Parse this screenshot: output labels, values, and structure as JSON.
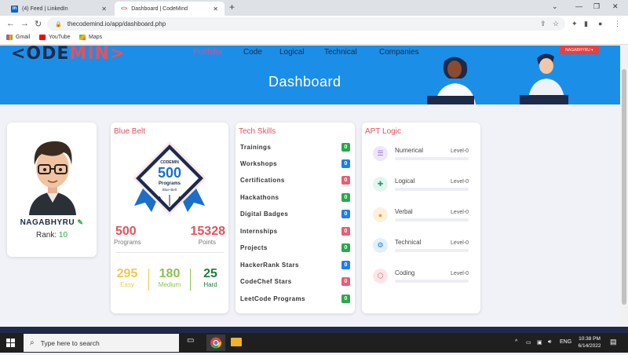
{
  "browser": {
    "tabs": [
      {
        "title": "(4) Feed | LinkedIn",
        "favicon": "linkedin-icon",
        "active": false
      },
      {
        "title": "Dashboard | CodeMind",
        "favicon": "codemind-icon",
        "active": true
      }
    ],
    "url": "thecodemind.io/app/dashboard.php",
    "bookmarks": [
      {
        "label": "Gmail",
        "icon": "gmail-icon"
      },
      {
        "label": "YouTube",
        "icon": "youtube-icon"
      },
      {
        "label": "Maps",
        "icon": "maps-icon"
      }
    ]
  },
  "site": {
    "logo_prefix": "<ODE",
    "logo_mid": "MIN",
    "logo_suffix": ">",
    "nav": [
      "Portfolio",
      "Code",
      "Logical",
      "Technical",
      "Companies"
    ],
    "active_nav": "Portfolio",
    "user_button": "NAGABHYRU ▾",
    "page_title": "Dashboard"
  },
  "profile": {
    "name": "NAGABHYRU",
    "rank_label": "Rank:",
    "rank_value": "10"
  },
  "belt": {
    "title": "Blue Belt",
    "badge": {
      "logo": "CODEMIN",
      "number": "500",
      "label": "Programs",
      "belt_label": "Blue-Belt"
    },
    "programs_value": "500",
    "programs_label": "Programs",
    "points_value": "15328",
    "points_label": "Points",
    "difficulties": [
      {
        "value": "295",
        "label": "Easy",
        "color": "#f2c94c"
      },
      {
        "value": "180",
        "label": "Medium",
        "color": "#8bc34a"
      },
      {
        "value": "25",
        "label": "Hard",
        "color": "#1e7d3a"
      }
    ]
  },
  "tech_skills": {
    "title": "Tech Skills",
    "items": [
      {
        "label": "Trainings",
        "value": "0",
        "color": "#2aa84a"
      },
      {
        "label": "Workshops",
        "value": "0",
        "color": "#1b7fe7"
      },
      {
        "label": "Certifications",
        "value": "0",
        "color": "#e85d75"
      },
      {
        "label": "Hackathons",
        "value": "0",
        "color": "#2aa84a"
      },
      {
        "label": "Digital Badges",
        "value": "0",
        "color": "#1b7fe7"
      },
      {
        "label": "Internships",
        "value": "0",
        "color": "#e85d75"
      },
      {
        "label": "Projects",
        "value": "0",
        "color": "#2aa84a"
      },
      {
        "label": "HackerRank Stars",
        "value": "0",
        "color": "#1b7fe7"
      },
      {
        "label": "CodeChef Stars",
        "value": "0",
        "color": "#e85d75"
      },
      {
        "label": "LeetCode Programs",
        "value": "0",
        "color": "#2aa84a"
      }
    ]
  },
  "apt_logic": {
    "title": "APT Logic",
    "items": [
      {
        "label": "Numerical",
        "level": "Level-0",
        "icon": "list-icon",
        "icon_bg": "#efe6fb",
        "icon_color": "#8e6bd8"
      },
      {
        "label": "Logical",
        "level": "Level-0",
        "icon": "puzzle-icon",
        "icon_bg": "#e2f5ef",
        "icon_color": "#1e9e7a"
      },
      {
        "label": "Verbal",
        "level": "Level-0",
        "icon": "chat-icon",
        "icon_bg": "#fdf1dc",
        "icon_color": "#e8a13a"
      },
      {
        "label": "Technical",
        "level": "Level-0",
        "icon": "gears-icon",
        "icon_bg": "#e3effc",
        "icon_color": "#1b7fe7"
      },
      {
        "label": "Coding",
        "level": "Level-0",
        "icon": "hexagon-icon",
        "icon_bg": "#fde6e9",
        "icon_color": "#e85d75"
      }
    ]
  },
  "taskbar": {
    "search_placeholder": "Type here to search",
    "language": "ENG",
    "time": "10:38 PM",
    "date": "6/14/2022"
  }
}
